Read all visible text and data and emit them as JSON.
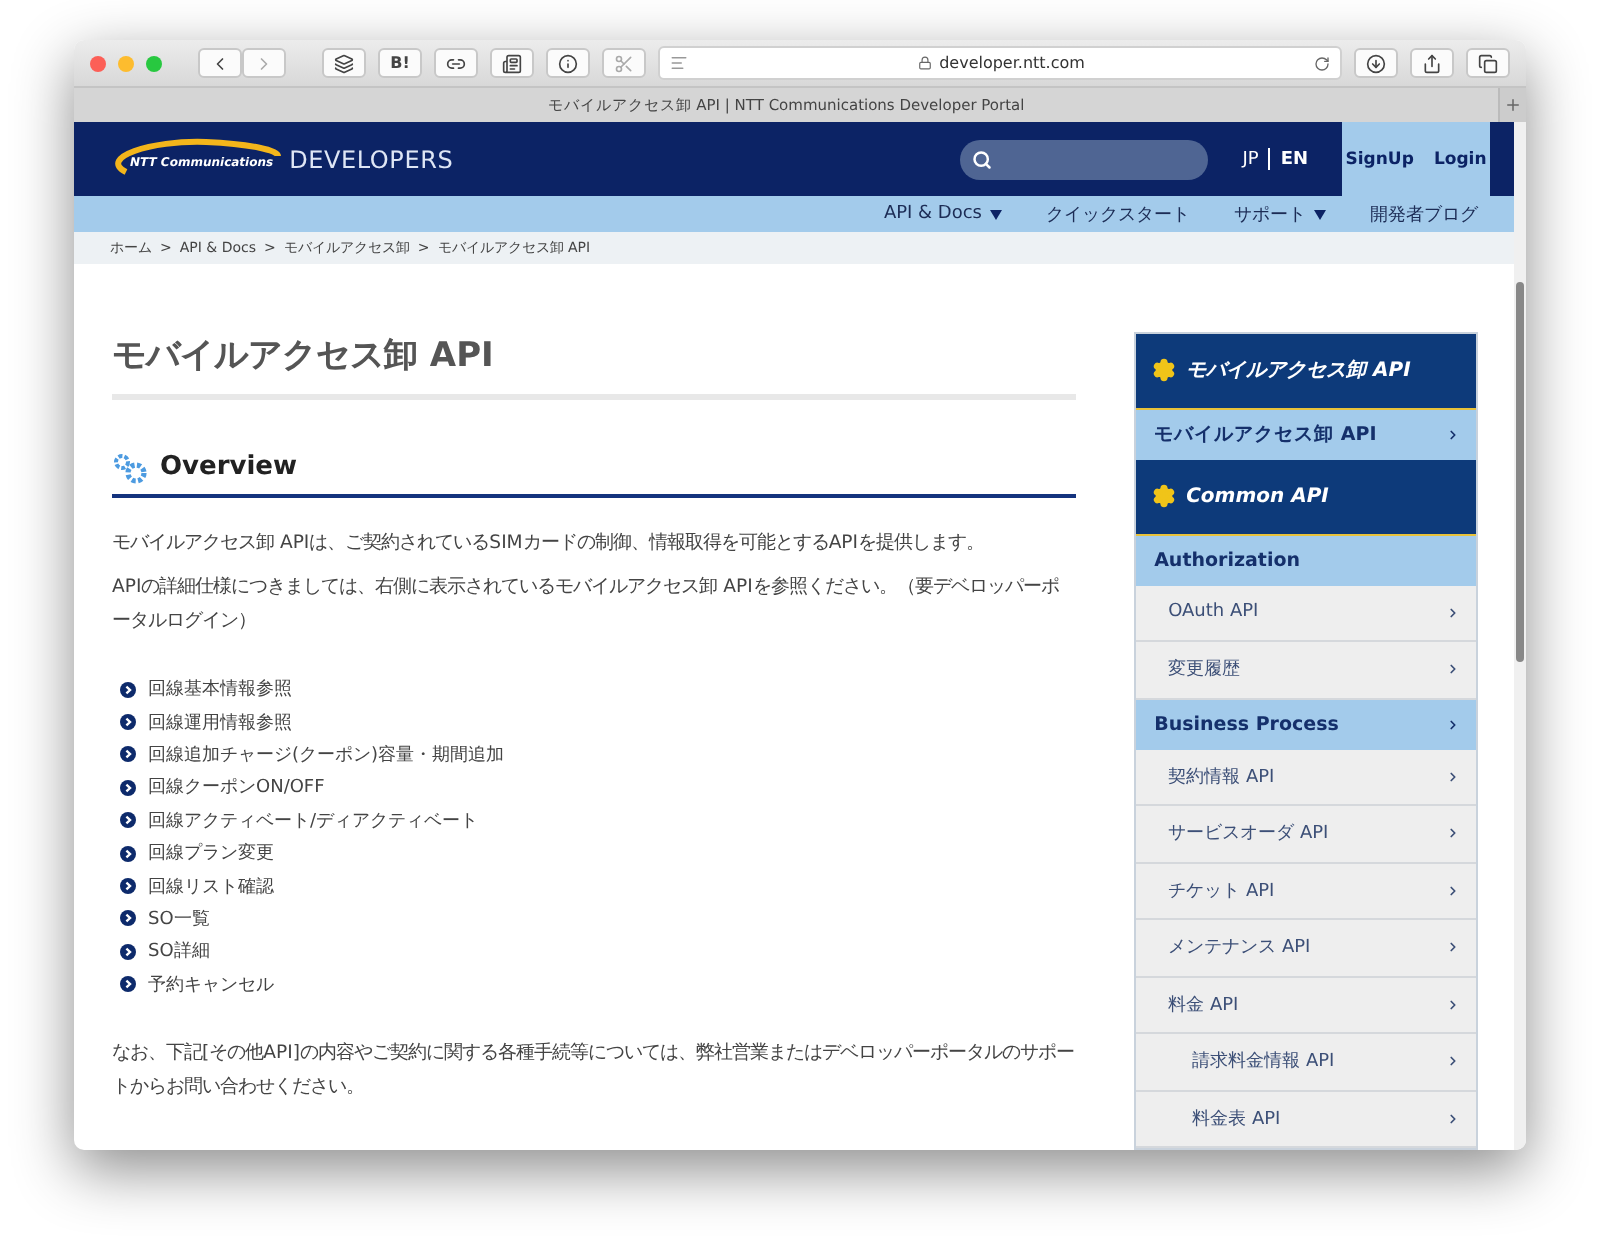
{
  "browser": {
    "bookmark_label": "B!",
    "url": "developer.ntt.com",
    "tab_title": "モバイルアクセス卸 API | NTT Communications Developer Portal"
  },
  "header": {
    "logo_text": "NTT Communications",
    "brand": "DEVELOPERS",
    "languages": [
      {
        "label": "JP",
        "selected": false
      },
      {
        "label": "EN",
        "selected": true
      }
    ],
    "account_links": [
      "SignUp",
      "Login"
    ]
  },
  "nav": [
    {
      "label": "API & Docs",
      "dropdown": true
    },
    {
      "label": "クイックスタート",
      "dropdown": false
    },
    {
      "label": "サポート",
      "dropdown": true
    },
    {
      "label": "開発者ブログ",
      "dropdown": false
    }
  ],
  "breadcrumb_separator": ">",
  "breadcrumb": [
    "ホーム",
    "API & Docs",
    "モバイルアクセス卸",
    "モバイルアクセス卸 API"
  ],
  "page_title": "モバイルアクセス卸 API",
  "section_heading": "Overview",
  "paragraphs": [
    "モバイルアクセス卸 APIは、ご契約されているSIMカードの制御、情報取得を可能とするAPIを提供します。",
    "APIの詳細仕様につきましては、右側に表示されているモバイルアクセス卸 APIを参照ください。（要デベロッパーポータルログイン）"
  ],
  "features": [
    "回線基本情報参照",
    "回線運用情報参照",
    "回線追加チャージ(クーポン)容量・期間追加",
    "回線クーポンON/OFF",
    "回線アクティベート/ディアクティベート",
    "回線プラン変更",
    "回線リスト確認",
    "SO一覧",
    "SO詳細",
    "予約キャンセル"
  ],
  "note": "なお、下記[その他API]の内容やご契約に関する各種手続等については、弊社営業またはデベロッパーポータルのサポートからお問い合わせください。",
  "sidebar": [
    {
      "kind": "header",
      "label": "モバイルアクセス卸 API"
    },
    {
      "kind": "category",
      "label": "モバイルアクセス卸 API",
      "arrow": true
    },
    {
      "kind": "header",
      "label": "Common API"
    },
    {
      "kind": "category",
      "label": "Authorization",
      "arrow": false
    },
    {
      "kind": "item",
      "label": "OAuth API"
    },
    {
      "kind": "item",
      "label": "変更履歴"
    },
    {
      "kind": "category",
      "label": "Business Process",
      "arrow": true
    },
    {
      "kind": "item",
      "label": "契約情報 API"
    },
    {
      "kind": "item",
      "label": "サービスオーダ API"
    },
    {
      "kind": "item",
      "label": "チケット API"
    },
    {
      "kind": "item",
      "label": "メンテナンス API"
    },
    {
      "kind": "item",
      "label": "料金 API"
    },
    {
      "kind": "subitem",
      "label": "請求料金情報 API"
    },
    {
      "kind": "subitem",
      "label": "料金表 API"
    }
  ]
}
